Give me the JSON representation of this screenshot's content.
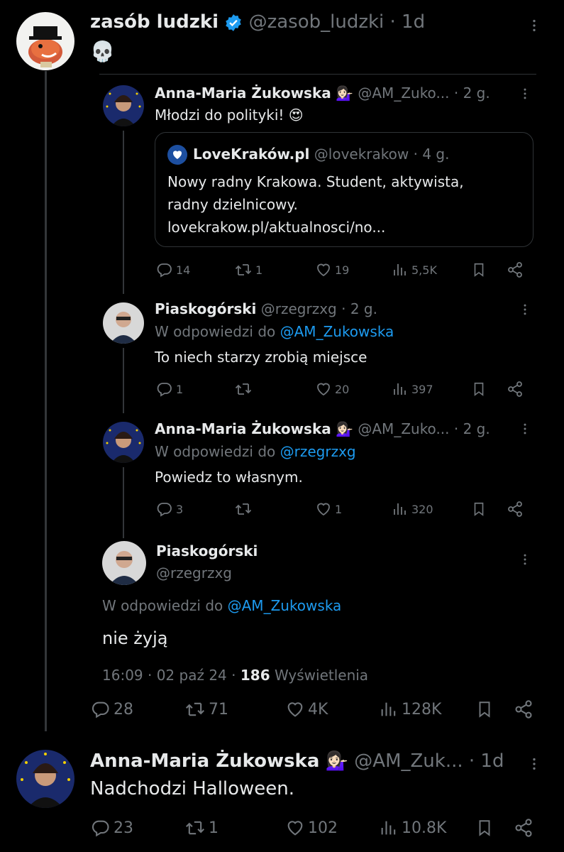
{
  "main_tweet": {
    "name": "zasób ludzki",
    "handle": "@zasob_ludzki",
    "time": "· 1d",
    "text": "💀"
  },
  "quoted_thread": [
    {
      "name": "Anna-Maria Żukowska",
      "emoji": "💁🏻‍♀️",
      "handle": "@AM_Zuko...",
      "time": "· 2 g.",
      "text": "Młodzi do polityki! 😍",
      "quote": {
        "name": "LoveKraków.pl",
        "handle": "@lovekrakow",
        "time": "· 4 g.",
        "text_lines": [
          "Nowy radny Krakowa. Student, aktywista,",
          "radny dzielnicowy.",
          "lovekrakow.pl/aktualnosci/no..."
        ]
      },
      "stats": {
        "replies": "14",
        "retweets": "1",
        "likes": "19",
        "views": "5,5K"
      }
    },
    {
      "name": "Piaskogórski",
      "handle": "@rzegrzxg",
      "time": "· 2 g.",
      "reply_prefix": "W odpowiedzi do",
      "reply_to": "@AM_Zukowska",
      "text": "To niech starzy zrobią miejsce",
      "stats": {
        "replies": "1",
        "retweets": "",
        "likes": "20",
        "views": "397"
      }
    },
    {
      "name": "Anna-Maria Żukowska",
      "emoji": "💁🏻‍♀️",
      "handle": "@AM_Zuko...",
      "time": "· 2 g.",
      "reply_prefix": "W odpowiedzi do",
      "reply_to": "@rzegrzxg",
      "text": "Powiedz to własnym.",
      "stats": {
        "replies": "3",
        "retweets": "",
        "likes": "1",
        "views": "320"
      }
    },
    {
      "name": "Piaskogórski",
      "handle": "@rzegrzxg",
      "reply_prefix": "W odpowiedzi do",
      "reply_to": "@AM_Zukowska",
      "text": "nie żyją",
      "timestamp": "16:09 · 02 paź 24 ·",
      "views_count": "186",
      "views_label": "Wyświetlenia"
    }
  ],
  "main_stats": {
    "replies": "28",
    "retweets": "71",
    "likes": "4K",
    "views": "128K"
  },
  "reply_tweet": {
    "name": "Anna-Maria Żukowska",
    "emoji": "💁🏻‍♀️",
    "handle": "@AM_Zuk...",
    "time": "· 1d",
    "text": "Nadchodzi Halloween.",
    "stats": {
      "replies": "23",
      "retweets": "1",
      "likes": "102",
      "views": "10.8K"
    }
  },
  "colors": {
    "background": "#000000",
    "text": "#e7e9ea",
    "muted": "#71767b",
    "link": "#1d9bf0",
    "border": "#2f3336"
  }
}
